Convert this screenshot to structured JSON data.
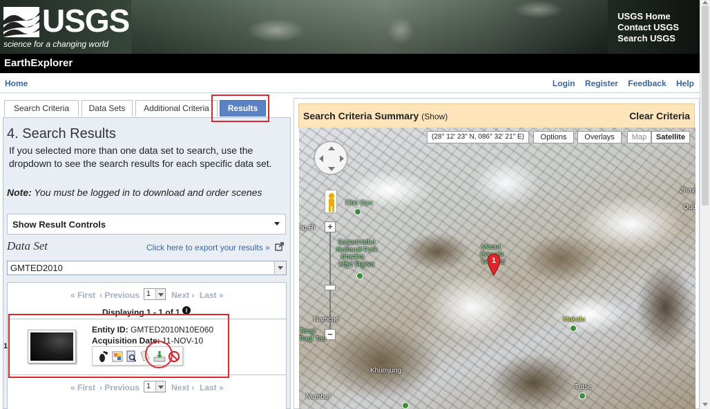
{
  "header": {
    "logo_text": "USGS",
    "logo_tagline": "science for a changing world",
    "top_links": [
      "USGS Home",
      "Contact USGS",
      "Search USGS"
    ]
  },
  "appbar": {
    "title": "EarthExplorer"
  },
  "nav": {
    "home": "Home",
    "right": [
      "Login",
      "Register",
      "Feedback",
      "Help"
    ]
  },
  "tabs": [
    "Search Criteria",
    "Data Sets",
    "Additional Criteria",
    "Results"
  ],
  "results": {
    "title": "4. Search Results",
    "intro": "If you selected more than one data set to search, use the dropdown to see the search results for each specific data set.",
    "note_label": "Note:",
    "note_text": " You must be logged in to download and order scenes",
    "show_controls": "Show Result Controls",
    "dataset_label": "Data Set",
    "export_link": "Click here to export your results »",
    "dataset_selected": "GMTED2010",
    "pager": {
      "first": "« First",
      "previous": "‹ Previous",
      "page": "1",
      "next": "Next ›",
      "last": "Last »"
    },
    "displaying": "Displaying 1 - 1 of 1",
    "row_number": "1",
    "entity_label": "Entity ID:",
    "entity_id": " GMTED2010N10E060",
    "acq_label": "Acquisition Date:",
    "acq_date": " 11-NOV-10",
    "action_icons": [
      "footprint-icon",
      "overlay-icon",
      "metadata-icon",
      "compare-icon",
      "download-icon",
      "exclude-icon"
    ]
  },
  "summary": {
    "title": "Search Criteria Summary",
    "show": "(Show)",
    "clear": "Clear Criteria"
  },
  "map": {
    "coordinates": "(28° 12' 23\" N, 086° 32' 21\" E)",
    "buttons": [
      "Options",
      "Overlays",
      "Map",
      "Satellite"
    ],
    "labels": {
      "cho_oyu": "Cho Oyu",
      "sagarmatha1": "Sagarmatha",
      "sagarmatha2": "National Park",
      "sagarmatha3": "सगरमाथा",
      "sagarmatha4": "राष्ट्रिय निकुञ्ज",
      "everest1": "Mount",
      "everest2": "Everest",
      "everest3": "सगरमाथा",
      "zhaxi": "Zhaxi",
      "qud": "Qud",
      "tagril": "ag Ri",
      "namche": "Namche",
      "tengi1": "Tengi",
      "tengi2": "Ragi Tau",
      "makalu": "Makalu",
      "khumjung": "Khumjung",
      "tutse": "Tutse",
      "numbur": "Numbur"
    },
    "marker_number": "1"
  },
  "colors": {
    "accent_tab": "#5b82c4",
    "link": "#3366aa",
    "highlight": "#e0262b",
    "summary_bg": "#fde5b9"
  }
}
